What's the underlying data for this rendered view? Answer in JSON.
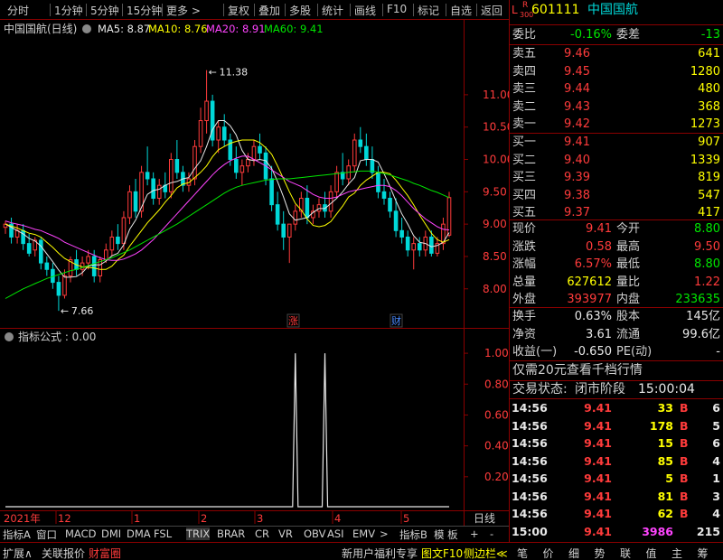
{
  "toolbar": {
    "items": [
      "分时",
      "1分钟",
      "5分钟",
      "15分钟",
      "更多 >",
      "复权",
      "叠加",
      "多股",
      "统计",
      "画线",
      "F10",
      "标记",
      "自选",
      "返回"
    ]
  },
  "stock": {
    "code": "601111",
    "name": "中国国航",
    "badge_top": "R",
    "badge_bot": "300",
    "badge_l": "L"
  },
  "chart": {
    "header_name": "中国国航(日线)",
    "ma": [
      {
        "label": "MA5: 8.87",
        "color": "#e8e8e8"
      },
      {
        "label": "MA10: 8.76",
        "color": "#ffff00"
      },
      {
        "label": "MA20: 8.91",
        "color": "#ff44ff"
      },
      {
        "label": "MA60: 9.41",
        "color": "#00e600"
      }
    ],
    "max_label": "11.38",
    "min_label": "7.66",
    "ylim": [
      7.55,
      11.85
    ],
    "yticks": [
      {
        "v": 11.0,
        "t": "11.00"
      },
      {
        "v": 10.5,
        "t": "10.50"
      },
      {
        "v": 10.0,
        "t": "10.00"
      },
      {
        "v": 9.5,
        "t": "9.50"
      },
      {
        "v": 9.0,
        "t": "9.00"
      },
      {
        "v": 8.5,
        "t": "8.50"
      },
      {
        "v": 8.0,
        "t": "8.00"
      }
    ],
    "mark_zhang": "涨",
    "mark_cai": "财",
    "mark_colors": {
      "zhang": "#ff3b3b",
      "cai": "#4a8bff"
    }
  },
  "indicator": {
    "title": "指标公式 : 0.00",
    "ylim": [
      0,
      1.1
    ],
    "yticks": [
      {
        "v": 1.0,
        "t": "1.00"
      },
      {
        "v": 0.8,
        "t": "0.80"
      },
      {
        "v": 0.6,
        "t": "0.60"
      },
      {
        "v": 0.4,
        "t": "0.40"
      },
      {
        "v": 0.2,
        "t": "0.20"
      }
    ]
  },
  "xaxis": {
    "labels": [
      {
        "t": "2021年",
        "c": "#ff3b3b"
      },
      {
        "t": "12",
        "c": "#ff3b3b"
      },
      {
        "t": "1",
        "c": "#ff3b3b"
      },
      {
        "t": "2",
        "c": "#ff3b3b"
      },
      {
        "t": "3",
        "c": "#ff3b3b"
      },
      {
        "t": "4",
        "c": "#ff3b3b"
      },
      {
        "t": "5",
        "c": "#ff3b3b"
      }
    ],
    "right": "日线"
  },
  "tabs": [
    "指标A",
    "窗口",
    "MACD",
    "DMI",
    "DMA",
    "FSL",
    "TRIX",
    "BRAR",
    "CR",
    "VR",
    "OBV",
    "ASI",
    "EMV",
    ">",
    "指标B",
    "模 板",
    "+",
    "-"
  ],
  "bottombar": {
    "left": [
      "扩展∧",
      "关联报价",
      "财富圈"
    ],
    "mid": [
      "新用户福利专享",
      "图文F10",
      "侧边栏≪"
    ],
    "right": [
      "笔",
      "价",
      "细",
      "势",
      "联",
      "值",
      "主",
      "筹"
    ]
  },
  "quote": {
    "weibi_label": "委比",
    "weibi_val": "-0.16%",
    "weicha_label": "委差",
    "weicha_val": "-13",
    "sells": [
      {
        "l": "卖五",
        "p": "9.46",
        "v": "641"
      },
      {
        "l": "卖四",
        "p": "9.45",
        "v": "1280"
      },
      {
        "l": "卖三",
        "p": "9.44",
        "v": "480"
      },
      {
        "l": "卖二",
        "p": "9.43",
        "v": "368"
      },
      {
        "l": "卖一",
        "p": "9.42",
        "v": "1273"
      }
    ],
    "buys": [
      {
        "l": "买一",
        "p": "9.41",
        "v": "907"
      },
      {
        "l": "买二",
        "p": "9.40",
        "v": "1339"
      },
      {
        "l": "买三",
        "p": "9.39",
        "v": "819"
      },
      {
        "l": "买四",
        "p": "9.38",
        "v": "547"
      },
      {
        "l": "买五",
        "p": "9.37",
        "v": "417"
      }
    ],
    "stats": [
      {
        "l1": "现价",
        "v1": "9.41",
        "c1": "red",
        "l2": "今开",
        "v2": "8.80",
        "c2": "grn"
      },
      {
        "l1": "涨跌",
        "v1": "0.58",
        "c1": "red",
        "l2": "最高",
        "v2": "9.50",
        "c2": "red"
      },
      {
        "l1": "涨幅",
        "v1": "6.57%",
        "c1": "red",
        "l2": "最低",
        "v2": "8.80",
        "c2": "grn"
      },
      {
        "l1": "总量",
        "v1": "627612",
        "c1": "yel",
        "l2": "量比",
        "v2": "1.22",
        "c2": "red"
      },
      {
        "l1": "外盘",
        "v1": "393977",
        "c1": "red",
        "l2": "内盘",
        "v2": "233635",
        "c2": "grn"
      }
    ],
    "stats2": [
      {
        "l1": "换手",
        "v1": "0.63%",
        "l2": "股本",
        "v2": "145亿"
      },
      {
        "l1": "净资",
        "v1": "3.61",
        "l2": "流通",
        "v2": "99.6亿"
      },
      {
        "l1": "收益(一)",
        "v1": "-0.650",
        "l2": "PE(动)",
        "v2": "-"
      }
    ],
    "promo": "仅需20元查看千档行情",
    "status_label": "交易状态:",
    "status_val": "闭市阶段",
    "status_time": "15:00:04",
    "ticks": [
      {
        "t": "14:56",
        "p": "9.41",
        "v": "33",
        "f": "B",
        "n": "6"
      },
      {
        "t": "14:56",
        "p": "9.41",
        "v": "178",
        "f": "B",
        "n": "5"
      },
      {
        "t": "14:56",
        "p": "9.41",
        "v": "15",
        "f": "B",
        "n": "6"
      },
      {
        "t": "14:56",
        "p": "9.41",
        "v": "85",
        "f": "B",
        "n": "4"
      },
      {
        "t": "14:56",
        "p": "9.41",
        "v": "5",
        "f": "B",
        "n": "1"
      },
      {
        "t": "14:56",
        "p": "9.41",
        "v": "81",
        "f": "B",
        "n": "3"
      },
      {
        "t": "14:56",
        "p": "9.41",
        "v": "62",
        "f": "B",
        "n": "4"
      },
      {
        "t": "15:00",
        "p": "9.41",
        "v": "3986",
        "f": "",
        "n": "215"
      }
    ]
  },
  "chart_data": {
    "type": "candlestick",
    "candles": [
      [
        8.95,
        9.05,
        8.85,
        9.0
      ],
      [
        9.0,
        9.1,
        8.7,
        8.8
      ],
      [
        8.8,
        9.0,
        8.7,
        8.9
      ],
      [
        8.9,
        9.0,
        8.6,
        8.7
      ],
      [
        8.7,
        8.85,
        8.5,
        8.55
      ],
      [
        8.6,
        8.8,
        8.5,
        8.75
      ],
      [
        8.75,
        8.8,
        8.3,
        8.4
      ],
      [
        8.4,
        8.5,
        8.2,
        8.3
      ],
      [
        8.3,
        8.4,
        8.0,
        8.1
      ],
      [
        8.1,
        8.2,
        7.66,
        7.9
      ],
      [
        7.9,
        8.3,
        7.85,
        8.2
      ],
      [
        8.2,
        8.5,
        8.1,
        8.45
      ],
      [
        8.45,
        8.6,
        8.2,
        8.3
      ],
      [
        8.3,
        8.5,
        8.2,
        8.4
      ],
      [
        8.4,
        8.6,
        8.3,
        8.5
      ],
      [
        8.5,
        8.6,
        8.1,
        8.2
      ],
      [
        8.2,
        8.5,
        8.1,
        8.45
      ],
      [
        8.45,
        8.7,
        8.4,
        8.6
      ],
      [
        8.6,
        8.9,
        8.5,
        8.8
      ],
      [
        8.8,
        9.0,
        8.6,
        8.7
      ],
      [
        8.7,
        9.2,
        8.6,
        9.1
      ],
      [
        9.1,
        9.6,
        9.0,
        9.5
      ],
      [
        9.5,
        9.7,
        9.1,
        9.2
      ],
      [
        9.2,
        9.9,
        9.1,
        9.8
      ],
      [
        9.8,
        10.2,
        9.6,
        9.7
      ],
      [
        9.7,
        9.8,
        9.3,
        9.4
      ],
      [
        9.4,
        9.7,
        9.3,
        9.6
      ],
      [
        9.6,
        9.8,
        9.4,
        9.5
      ],
      [
        9.5,
        10.1,
        9.4,
        10.0
      ],
      [
        10.0,
        10.3,
        9.7,
        9.8
      ],
      [
        9.8,
        9.9,
        9.5,
        9.6
      ],
      [
        9.6,
        9.8,
        9.5,
        9.7
      ],
      [
        9.7,
        10.3,
        9.6,
        10.2
      ],
      [
        10.2,
        10.8,
        10.1,
        10.6
      ],
      [
        10.6,
        11.38,
        10.4,
        10.9
      ],
      [
        10.9,
        11.0,
        10.2,
        10.3
      ],
      [
        10.3,
        10.6,
        10.1,
        10.5
      ],
      [
        10.5,
        10.7,
        10.2,
        10.3
      ],
      [
        10.3,
        10.4,
        9.9,
        10.0
      ],
      [
        10.0,
        10.2,
        9.7,
        9.8
      ],
      [
        9.8,
        10.0,
        9.6,
        9.9
      ],
      [
        9.9,
        10.1,
        9.8,
        10.0
      ],
      [
        10.0,
        10.3,
        9.9,
        10.2
      ],
      [
        10.2,
        10.4,
        10.0,
        10.1
      ],
      [
        10.1,
        10.2,
        9.6,
        9.7
      ],
      [
        9.7,
        9.9,
        9.2,
        9.3
      ],
      [
        9.3,
        9.5,
        8.9,
        9.0
      ],
      [
        9.0,
        9.2,
        8.6,
        8.8
      ],
      [
        8.8,
        9.0,
        8.4,
        9.0
      ],
      [
        9.0,
        9.3,
        8.9,
        9.2
      ],
      [
        9.2,
        9.5,
        9.1,
        9.4
      ],
      [
        9.4,
        9.6,
        9.0,
        9.1
      ],
      [
        9.1,
        9.3,
        9.0,
        9.2
      ],
      [
        9.2,
        9.4,
        9.1,
        9.3
      ],
      [
        9.3,
        9.5,
        9.1,
        9.2
      ],
      [
        9.2,
        9.6,
        9.1,
        9.5
      ],
      [
        9.5,
        9.9,
        9.4,
        9.8
      ],
      [
        9.8,
        10.1,
        9.6,
        9.7
      ],
      [
        9.7,
        10.0,
        9.6,
        9.9
      ],
      [
        9.9,
        10.4,
        9.8,
        10.3
      ],
      [
        10.3,
        10.5,
        10.1,
        10.2
      ],
      [
        10.2,
        10.4,
        9.9,
        10.0
      ],
      [
        10.0,
        10.2,
        9.7,
        9.8
      ],
      [
        9.8,
        9.9,
        9.4,
        9.5
      ],
      [
        9.5,
        9.7,
        9.3,
        9.4
      ],
      [
        9.4,
        9.5,
        9.1,
        9.2
      ],
      [
        9.2,
        9.4,
        8.8,
        8.9
      ],
      [
        8.9,
        9.1,
        8.7,
        8.8
      ],
      [
        8.8,
        8.9,
        8.5,
        8.6
      ],
      [
        8.6,
        8.8,
        8.3,
        8.7
      ],
      [
        8.7,
        8.8,
        8.5,
        8.6
      ],
      [
        8.6,
        8.9,
        8.5,
        8.8
      ],
      [
        8.8,
        8.9,
        8.5,
        8.55
      ],
      [
        8.55,
        8.8,
        8.5,
        8.7
      ],
      [
        8.7,
        9.1,
        8.6,
        9.0
      ],
      [
        8.83,
        9.5,
        8.8,
        9.41
      ]
    ],
    "ma_series": [
      {
        "name": "MA5",
        "color": "#e8e8e8",
        "values": [
          9.0,
          8.95,
          8.9,
          8.85,
          8.78,
          8.74,
          8.66,
          8.54,
          8.42,
          8.29,
          8.18,
          8.18,
          8.19,
          8.25,
          8.35,
          8.37,
          8.37,
          8.43,
          8.51,
          8.55,
          8.68,
          8.92,
          9.06,
          9.26,
          9.46,
          9.52,
          9.54,
          9.6,
          9.64,
          9.66,
          9.7,
          9.72,
          9.86,
          9.98,
          10.2,
          10.46,
          10.6,
          10.6,
          10.52,
          10.38,
          10.14,
          10.0,
          9.98,
          10.0,
          9.98,
          9.86,
          9.66,
          9.42,
          9.16,
          9.06,
          9.08,
          9.1,
          9.18,
          9.24,
          9.24,
          9.32,
          9.4,
          9.5,
          9.62,
          9.72,
          9.98,
          10.0,
          10.0,
          9.96,
          9.78,
          9.58,
          9.36,
          9.16,
          9.0,
          8.82,
          8.72,
          8.7,
          8.65,
          8.67,
          8.72,
          8.87
        ]
      },
      {
        "name": "MA10",
        "color": "#ffff00",
        "values": [
          9.0,
          8.97,
          8.94,
          8.9,
          8.86,
          8.84,
          8.8,
          8.72,
          8.64,
          8.55,
          8.47,
          8.42,
          8.37,
          8.34,
          8.33,
          8.32,
          8.3,
          8.3,
          8.35,
          8.45,
          8.52,
          8.66,
          8.78,
          8.9,
          9.02,
          9.12,
          9.22,
          9.34,
          9.44,
          9.56,
          9.62,
          9.64,
          9.72,
          9.8,
          9.9,
          10.04,
          10.15,
          10.2,
          10.25,
          10.28,
          10.3,
          10.3,
          10.3,
          10.26,
          10.18,
          10.08,
          9.9,
          9.7,
          9.5,
          9.32,
          9.22,
          9.08,
          8.98,
          8.96,
          8.98,
          9.04,
          9.16,
          9.28,
          9.42,
          9.48,
          9.6,
          9.68,
          9.74,
          9.8,
          9.8,
          9.78,
          9.68,
          9.56,
          9.44,
          9.3,
          9.14,
          9.0,
          8.86,
          8.76,
          8.72,
          8.76
        ]
      },
      {
        "name": "MA20",
        "color": "#ff44ff",
        "values": [
          9.05,
          9.02,
          9.0,
          8.98,
          8.95,
          8.92,
          8.9,
          8.86,
          8.82,
          8.78,
          8.72,
          8.68,
          8.64,
          8.6,
          8.56,
          8.52,
          8.48,
          8.45,
          8.44,
          8.44,
          8.46,
          8.5,
          8.54,
          8.6,
          8.68,
          8.76,
          8.86,
          8.96,
          9.06,
          9.16,
          9.26,
          9.36,
          9.46,
          9.56,
          9.66,
          9.76,
          9.85,
          9.92,
          9.98,
          10.02,
          10.05,
          10.05,
          10.0,
          9.95,
          9.9,
          9.84,
          9.78,
          9.72,
          9.66,
          9.62,
          9.58,
          9.52,
          9.46,
          9.42,
          9.4,
          9.4,
          9.42,
          9.46,
          9.5,
          9.52,
          9.54,
          9.56,
          9.58,
          9.6,
          9.6,
          9.58,
          9.52,
          9.44,
          9.34,
          9.24,
          9.16,
          9.08,
          9.02,
          8.96,
          8.92,
          8.91
        ]
      },
      {
        "name": "MA60",
        "color": "#00e600",
        "values": [
          7.85,
          7.9,
          7.95,
          8.0,
          8.04,
          8.08,
          8.12,
          8.16,
          8.19,
          8.22,
          8.25,
          8.28,
          8.3,
          8.33,
          8.36,
          8.39,
          8.42,
          8.45,
          8.48,
          8.52,
          8.56,
          8.6,
          8.65,
          8.7,
          8.75,
          8.8,
          8.85,
          8.9,
          8.95,
          9.0,
          9.06,
          9.12,
          9.18,
          9.24,
          9.3,
          9.36,
          9.42,
          9.48,
          9.53,
          9.57,
          9.6,
          9.62,
          9.64,
          9.66,
          9.68,
          9.69,
          9.7,
          9.7,
          9.7,
          9.71,
          9.72,
          9.73,
          9.74,
          9.75,
          9.76,
          9.77,
          9.78,
          9.79,
          9.8,
          9.81,
          9.82,
          9.82,
          9.82,
          9.8,
          9.78,
          9.76,
          9.73,
          9.7,
          9.67,
          9.63,
          9.6,
          9.56,
          9.52,
          9.49,
          9.45,
          9.41
        ]
      }
    ],
    "indicator_signal": [
      {
        "index": 49,
        "value": 1.0
      },
      {
        "index": 54,
        "value": 1.0
      }
    ]
  }
}
